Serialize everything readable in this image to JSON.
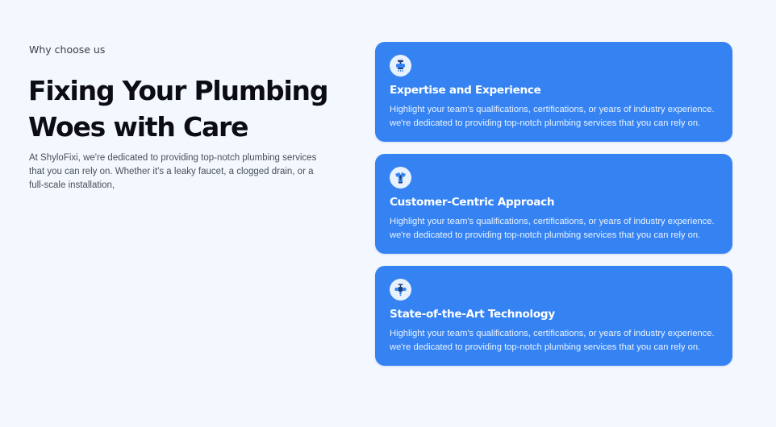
{
  "section": {
    "eyebrow": "Why choose us",
    "headline": "Fixing Your Plumbing Woes with Care",
    "intro": "At ShyloFixi, we're dedicated to providing top-notch plumbing services that you can rely on. Whether it's a leaky faucet, a clogged drain, or a full-scale installation,"
  },
  "features": [
    {
      "icon": "faucet-icon",
      "title": "Expertise and Experience",
      "text": "Highlight your team's qualifications, certifications, or years of industry experience. we're dedicated to providing top-notch plumbing services that you can rely on."
    },
    {
      "icon": "customer-service-icon",
      "title": "Customer-Centric Approach",
      "text": "Highlight your team's qualifications, certifications, or years of industry experience. we're dedicated to providing top-notch plumbing services that you can rely on."
    },
    {
      "icon": "pipe-valve-icon",
      "title": "State-of-the-Art Technology",
      "text": "Highlight your team's qualifications, certifications, or years of industry experience. we're dedicated to providing top-notch plumbing services that you can rely on."
    }
  ],
  "colors": {
    "background": "#f3f7fe",
    "card": "#3583f3",
    "icon_bg": "#e8f1fe",
    "icon_primary": "#3583f3",
    "icon_dark": "#1f3f7a"
  }
}
